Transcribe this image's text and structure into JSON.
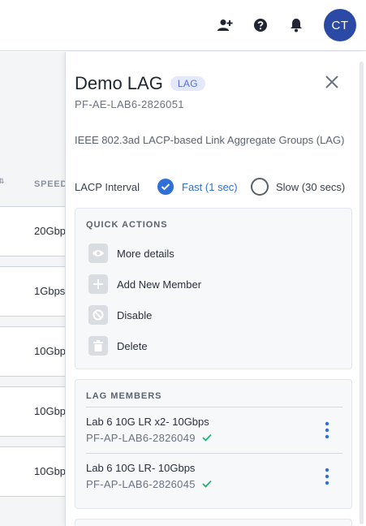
{
  "colors": {
    "accent": "#2f6fd7",
    "avatar_bg": "#2b4aa6",
    "badge_bg": "#e4e8fb",
    "badge_text": "#5570d8",
    "success": "#22b573"
  },
  "header": {
    "avatar_initials": "CT",
    "icons": [
      "add-user-icon",
      "help-icon",
      "bell-icon"
    ]
  },
  "background_table": {
    "speed_header": "SPEED",
    "rows": [
      "20Gbps",
      "1Gbps",
      "10Gbps",
      "10Gbps",
      "10Gbps"
    ]
  },
  "drawer": {
    "title": "Demo LAG",
    "badge": "LAG",
    "subtitle": "PF-AE-LAB6-2826051",
    "description": "IEEE 802.3ad LACP-based Link Aggregate Groups (LAG)",
    "lacp": {
      "label": "LACP Interval",
      "options": [
        {
          "label": "Fast (1 sec)",
          "selected": true
        },
        {
          "label": "Slow (30 secs)",
          "selected": false
        }
      ]
    },
    "quick_actions": {
      "title": "QUICK ACTIONS",
      "items": [
        {
          "label": "More details",
          "icon": "eye-icon"
        },
        {
          "label": "Add New Member",
          "icon": "plus-icon"
        },
        {
          "label": "Disable",
          "icon": "block-icon"
        },
        {
          "label": "Delete",
          "icon": "trash-icon"
        }
      ]
    },
    "lag_members": {
      "title": "LAG MEMBERS",
      "items": [
        {
          "name": "Lab 6 10G LR x2- 10Gbps",
          "id": "PF-AP-LAB6-2826049",
          "status": "check-icon"
        },
        {
          "name": "Lab 6 10G LR- 10Gbps",
          "id": "PF-AP-LAB6-2826045",
          "status": "check-icon"
        }
      ]
    }
  }
}
